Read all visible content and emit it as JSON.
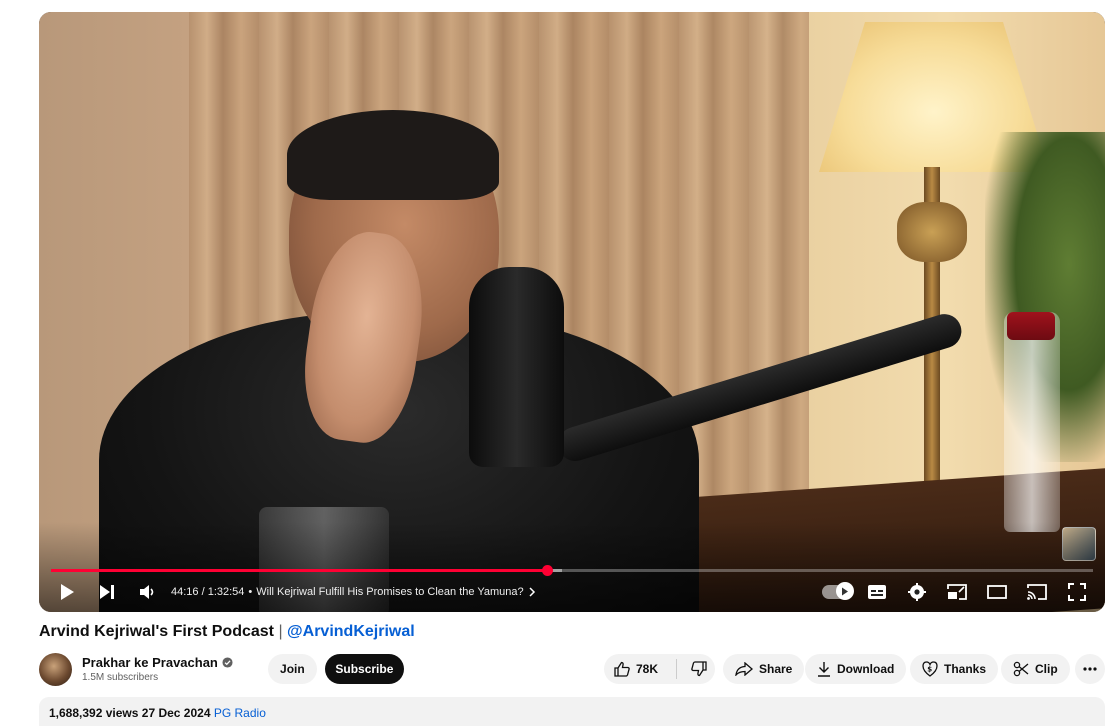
{
  "player": {
    "current_time": "44:16",
    "duration": "1:32:54",
    "time_separator": " / ",
    "chapter_bullet": "•",
    "chapter_title": "Will Kejriwal Fulfill His Promises to Clean the Yamuna?",
    "progress_fraction": 0.476,
    "buffer_fraction": 0.49,
    "accent_color": "#ff0033"
  },
  "video": {
    "title": "Arvind Kejriwal's First Podcast",
    "title_separator": "|",
    "title_handle": "@ArvindKejriwal"
  },
  "channel": {
    "name": "Prakhar ke Pravachan",
    "subscribers": "1.5M subscribers",
    "verified": true
  },
  "buttons": {
    "join": "Join",
    "subscribe": "Subscribe",
    "like_count": "78K",
    "share": "Share",
    "download": "Download",
    "thanks": "Thanks",
    "clip": "Clip"
  },
  "description": {
    "views": "1,688,392 views",
    "date": "27 Dec 2024",
    "hashtag": "PG Radio"
  },
  "icons": [
    "play-icon",
    "next-icon",
    "volume-icon",
    "autoplay-toggle",
    "subtitles-icon",
    "settings-icon",
    "miniplayer-icon",
    "theater-icon",
    "cast-icon",
    "fullscreen-icon",
    "like-icon",
    "dislike-icon",
    "share-icon",
    "download-icon",
    "thanks-icon",
    "clip-icon",
    "more-icon",
    "verified-icon"
  ]
}
